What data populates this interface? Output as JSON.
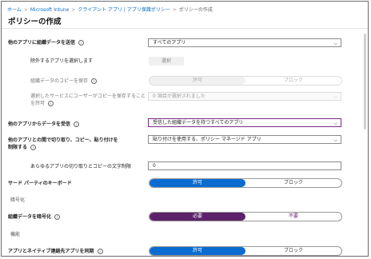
{
  "breadcrumb": {
    "items": [
      "ホーム",
      "Microsoft Intune",
      "クライアント アプリ | アプリ保護ポリシー",
      "ポリシーの作成"
    ],
    "separator": ">"
  },
  "page_title": "ポリシーの作成",
  "rows": {
    "send_data": {
      "label": "他のアプリに組織データを送信",
      "value": "すべてのアプリ"
    },
    "exempt_apps": {
      "label": "除外するアプリを選択します",
      "button": "選択"
    },
    "save_copies": {
      "label": "組織データのコピーを保存",
      "options": [
        "許可",
        "ブロック"
      ],
      "selected": "許可"
    },
    "allow_save_services": {
      "label_line1": "選択したサービスにユーザーがコピーを保存すること",
      "label_line2": "を許可",
      "value": "0 項目が選択されました"
    },
    "receive_data": {
      "label": "他のアプリからデータを受信",
      "value": "受信した組織データを持つすべてのアプリ"
    },
    "cut_copy_paste": {
      "label_line1": "他のアプリとの間で切り取り、コピー、貼り付けを",
      "label_line2": "制限する",
      "value": "貼り付けを使用する、ポリシー マネージド アプリ"
    },
    "char_limit": {
      "label": "あらゆるアプリの切り取りとコピーの文字制限",
      "value": "0"
    },
    "third_party_keyboard": {
      "label": "サード パーティのキーボード",
      "options": [
        "許可",
        "ブロック"
      ],
      "selected": "許可"
    },
    "encryption_section": "暗号化",
    "encrypt_org_data": {
      "label": "組織データを暗号化",
      "options": [
        "必要",
        "不要"
      ],
      "selected": "必要"
    },
    "functionality_section": "機能",
    "sync_contacts": {
      "label": "アプリとネイティブ連絡先アプリを同期",
      "options": [
        "許可",
        "ブロック"
      ],
      "selected": "許可"
    }
  },
  "colors": {
    "accent_blue": "#0a6cd1",
    "accent_purple": "#5c2269",
    "link": "#0b6cc4"
  },
  "icons": {
    "info": "info-icon",
    "dropdown": "chevron-down-icon"
  }
}
